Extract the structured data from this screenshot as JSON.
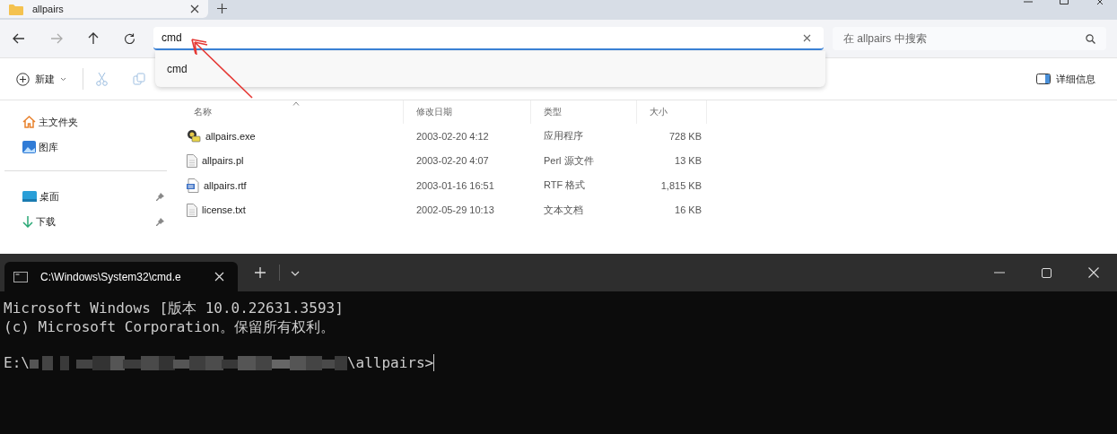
{
  "explorer": {
    "tab": {
      "title": "allpairs"
    },
    "address": {
      "value": "cmd",
      "focused": true
    },
    "suggestions": [
      {
        "label": "cmd"
      }
    ],
    "search": {
      "placeholder": "在 allpairs 中搜索"
    },
    "toolbar": {
      "new_label": "新建",
      "details_label": "详细信息"
    },
    "sidebar": {
      "sections": [
        {
          "items": [
            {
              "label": "主文件夹",
              "kind": "home",
              "pinned": false
            },
            {
              "label": "图库",
              "kind": "gallery",
              "pinned": false
            }
          ]
        },
        {
          "items": [
            {
              "label": "桌面",
              "kind": "desktop",
              "pinned": true
            },
            {
              "label": "下载",
              "kind": "download",
              "pinned": true
            }
          ]
        }
      ]
    },
    "columns": [
      {
        "label": "名称",
        "sorted": true
      },
      {
        "label": "修改日期",
        "sorted": false
      },
      {
        "label": "类型",
        "sorted": false
      },
      {
        "label": "大小",
        "sorted": false
      }
    ],
    "files": [
      {
        "kind": "exe",
        "name": "allpairs.exe",
        "modified": "2003-02-20 4:12",
        "type": "应用程序",
        "size": "728 KB"
      },
      {
        "kind": "text",
        "name": "allpairs.pl",
        "modified": "2003-02-20 4:07",
        "type": "Perl 源文件",
        "size": "13 KB"
      },
      {
        "kind": "rtf",
        "name": "allpairs.rtf",
        "modified": "2003-01-16 16:51",
        "type": "RTF 格式",
        "size": "1,815 KB"
      },
      {
        "kind": "text",
        "name": "license.txt",
        "modified": "2002-05-29 10:13",
        "type": "文本文档",
        "size": "16 KB"
      }
    ]
  },
  "terminal": {
    "tab": {
      "title": "C:\\Windows\\System32\\cmd.e"
    },
    "lines": [
      {
        "text": "Microsoft Windows [版本 10.0.22631.3593]"
      },
      {
        "text": "(c) Microsoft Corporation。保留所有权利。"
      }
    ],
    "prompt": {
      "start": "E:\\",
      "end": "\\allpairs>"
    }
  }
}
